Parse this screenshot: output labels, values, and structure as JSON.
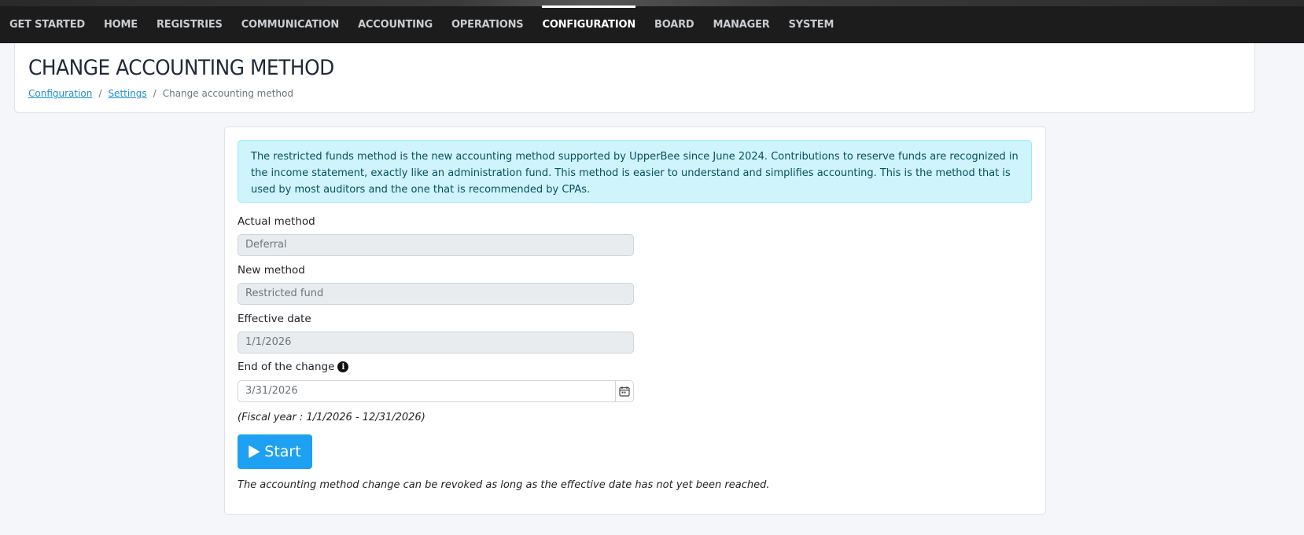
{
  "nav": {
    "items": [
      {
        "label": "GET STARTED",
        "active": false
      },
      {
        "label": "HOME",
        "active": false
      },
      {
        "label": "REGISTRIES",
        "active": false
      },
      {
        "label": "COMMUNICATION",
        "active": false
      },
      {
        "label": "ACCOUNTING",
        "active": false
      },
      {
        "label": "OPERATIONS",
        "active": false
      },
      {
        "label": "CONFIGURATION",
        "active": true
      },
      {
        "label": "BOARD",
        "active": false
      },
      {
        "label": "MANAGER",
        "active": false
      },
      {
        "label": "SYSTEM",
        "active": false
      }
    ]
  },
  "header": {
    "title": "CHANGE ACCOUNTING METHOD",
    "breadcrumb": {
      "item1": "Configuration",
      "item2": "Settings",
      "current": "Change accounting method",
      "separator": "/"
    }
  },
  "info": {
    "text": "The restricted funds method is the new accounting method supported by UpperBee since June 2024. Contributions to reserve funds are recognized in the income statement, exactly like an administration fund. This method is easier to understand and simplifies accounting. This is the method that is used by most auditors and the one that is recommended by CPAs."
  },
  "form": {
    "actual_label": "Actual method",
    "actual_value": "Deferral",
    "new_label": "New method",
    "new_value": "Restricted fund",
    "effective_label": "Effective date",
    "effective_value": "1/1/2026",
    "end_label": "End of the change",
    "end_value": "3/31/2026",
    "fiscal_text": "(Fiscal year : 1/1/2026 - 12/31/2026)",
    "start_label": "Start",
    "note": "The accounting method change can be revoked as long as the effective date has not yet been reached."
  },
  "colors": {
    "topbar": "#1c1c1c",
    "accent": "#1ea1f2",
    "info_bg": "#cff4fc",
    "link": "#1d8fd8"
  }
}
